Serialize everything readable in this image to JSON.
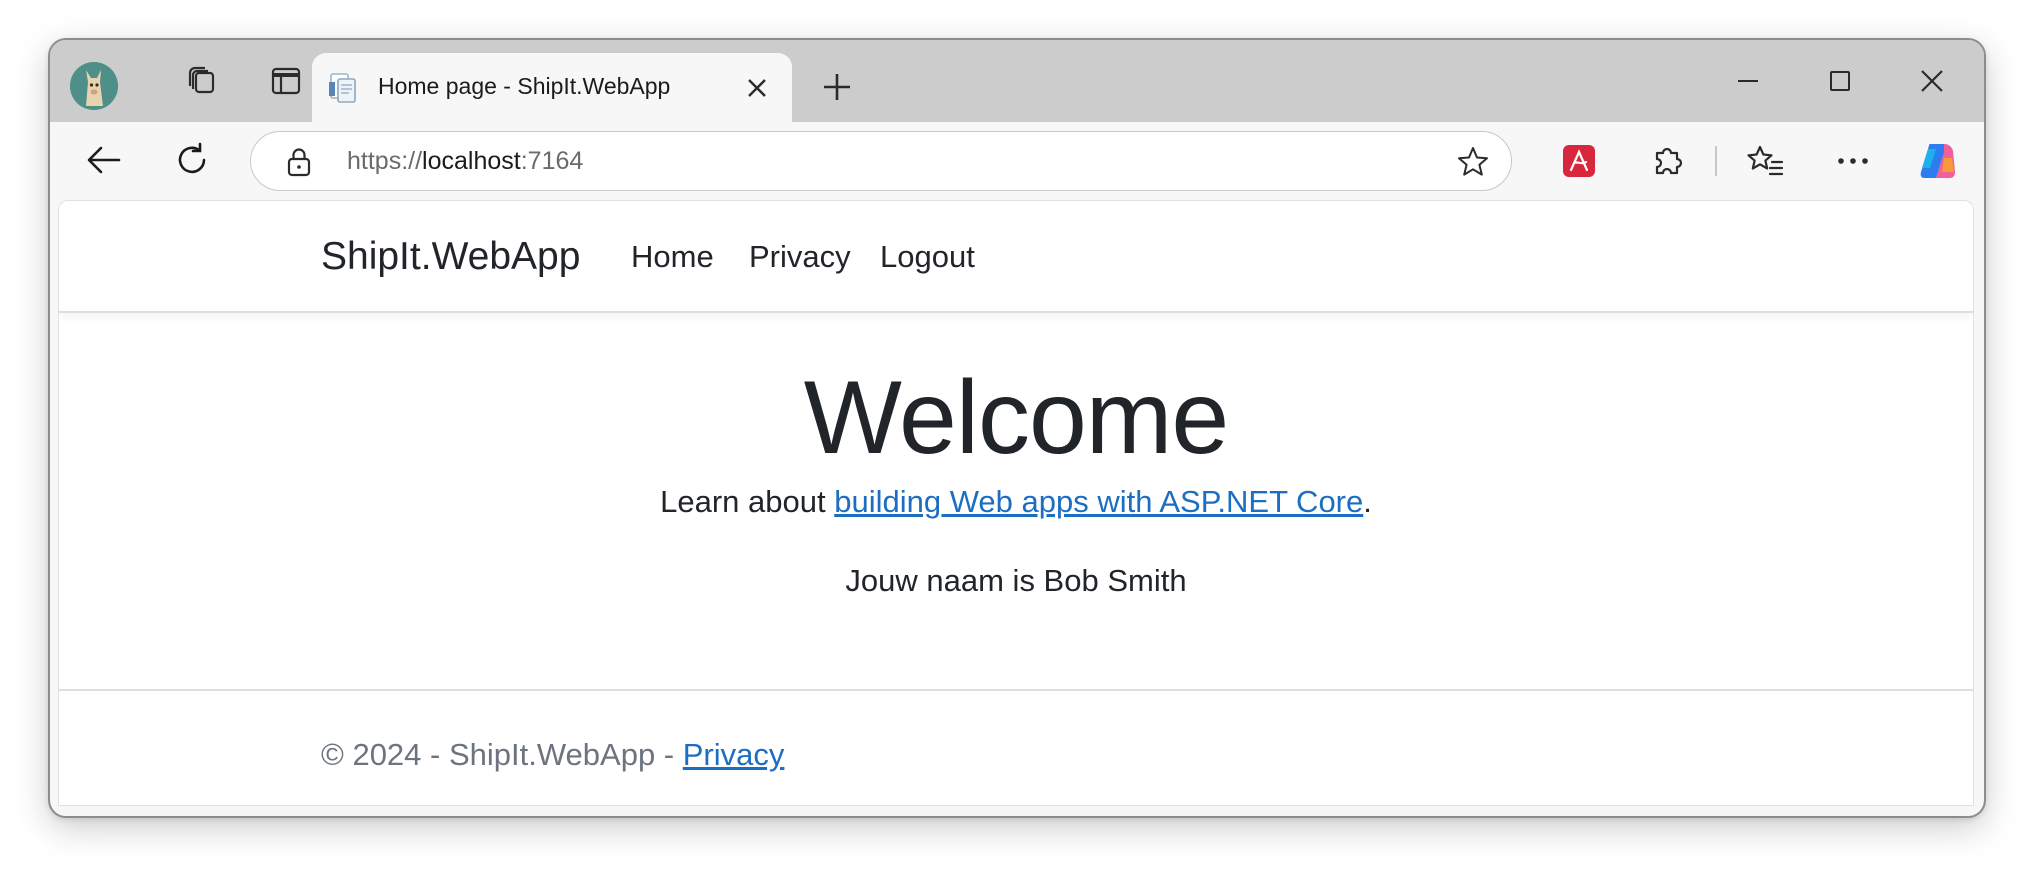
{
  "browser": {
    "tab": {
      "title": "Home page - ShipIt.WebApp"
    },
    "address": {
      "scheme": "https://",
      "host": "localhost",
      "port": ":7164"
    },
    "icons": {
      "profile": "profile-avatar-icon",
      "workspaces": "workspaces-icon",
      "tab_actions": "vertical-tabs-icon",
      "favicon": "document-favicon-icon",
      "close_tab": "close-icon",
      "new_tab": "plus-icon",
      "back": "back-arrow-icon",
      "refresh": "refresh-icon",
      "lock": "lock-icon",
      "favorite": "star-icon",
      "acrobat": "acrobat-extension-icon",
      "extensions": "puzzle-icon",
      "favorites": "favorites-icon",
      "more": "more-icon",
      "copilot": "copilot-icon"
    }
  },
  "site": {
    "brand": "ShipIt.WebApp",
    "nav": [
      {
        "label": "Home"
      },
      {
        "label": "Privacy"
      },
      {
        "label": "Logout"
      }
    ],
    "main": {
      "heading": "Welcome",
      "learn_prefix": "Learn about ",
      "learn_link": "building Web apps with ASP.NET Core",
      "learn_suffix": ".",
      "name_text": "Jouw naam is Bob Smith"
    },
    "footer": {
      "text": "© 2024 - ShipIt.WebApp - ",
      "link": "Privacy"
    }
  },
  "colors": {
    "link": "#1b6ec2",
    "text": "#212529",
    "muted": "#6c757d",
    "titlebar": "#cccccc",
    "acrobat": "#d7263d"
  }
}
